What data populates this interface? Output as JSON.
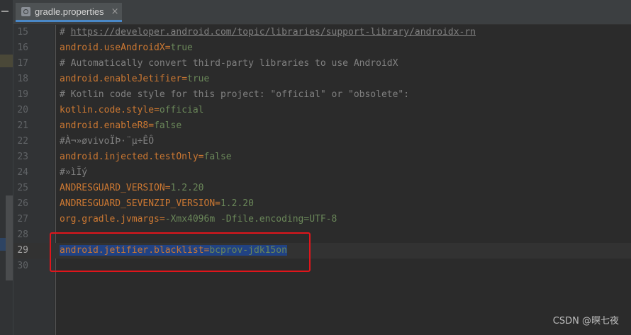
{
  "tab": {
    "label": "gradle.properties",
    "close_glyph": "×",
    "icon": "properties-file-icon"
  },
  "lines": [
    {
      "num": "15",
      "kind": "comment",
      "prefix": "# ",
      "text": "https://developer.android.com/topic/libraries/support-library/androidx-rn"
    },
    {
      "num": "16",
      "kind": "kv",
      "key": "android.useAndroidX",
      "eq": "=",
      "value": "true"
    },
    {
      "num": "17",
      "kind": "comment",
      "text": "# Automatically convert third-party libraries to use AndroidX"
    },
    {
      "num": "18",
      "kind": "kv",
      "key": "android.enableJetifier",
      "eq": "=",
      "value": "true"
    },
    {
      "num": "19",
      "kind": "comment",
      "text": "# Kotlin code style for this project: \"official\" or \"obsolete\":"
    },
    {
      "num": "20",
      "kind": "kv",
      "key": "kotlin.code.style",
      "eq": "=",
      "value": "official"
    },
    {
      "num": "21",
      "kind": "kv",
      "key": "android.enableR8",
      "eq": "=",
      "value": "false"
    },
    {
      "num": "22",
      "kind": "comment",
      "text": "#À¬»øvivoÏÞ·¨µ÷ÊÔ"
    },
    {
      "num": "23",
      "kind": "kv",
      "key": "android.injected.testOnly",
      "eq": "=",
      "value": "false"
    },
    {
      "num": "24",
      "kind": "comment",
      "text": "#»ìÏý"
    },
    {
      "num": "25",
      "kind": "kv",
      "key": "ANDRESGUARD_VERSION",
      "eq": "=",
      "value": "1.2.20"
    },
    {
      "num": "26",
      "kind": "kv",
      "key": "ANDRESGUARD_SEVENZIP_VERSION",
      "eq": "=",
      "value": "1.2.20"
    },
    {
      "num": "27",
      "kind": "kv",
      "key": "org.gradle.jvmargs",
      "eq": "=",
      "value": "-Xmx4096m -Dfile.encoding=UTF-8"
    },
    {
      "num": "28",
      "kind": "blank"
    },
    {
      "num": "29",
      "kind": "kv",
      "key": "android.jetifier.blacklist",
      "eq": "=",
      "value": "bcprov-jdk15on",
      "selected": true,
      "current": true
    },
    {
      "num": "30",
      "kind": "blank"
    }
  ],
  "watermark": "CSDN @暝七夜",
  "colors": {
    "background": "#2b2b2b",
    "key": "#cc7832",
    "value": "#6a8759",
    "comment": "#808080",
    "selection": "#214283",
    "annotation_box": "#e0151b"
  }
}
